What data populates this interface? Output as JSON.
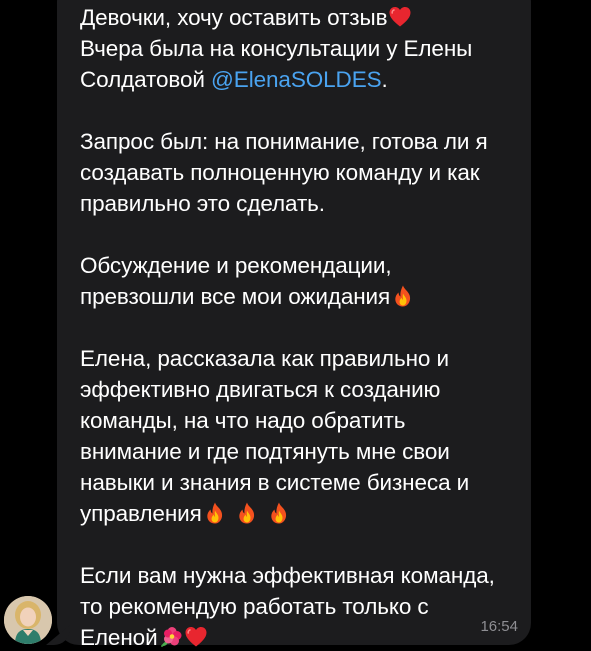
{
  "message": {
    "lines": [
      "Девочки, хочу оставить отзыв",
      "Вчера была на консультации у Елены",
      "Солдатовой ",
      "Запрос был: на понимание, готова ли я",
      "создавать полноценную команду и как",
      "правильно это сделать.",
      "Обсуждение и рекомендации,",
      "превзошли все мои ожидания",
      "Елена, рассказала как правильно и",
      "эффективно двигаться к созданию",
      "команды, на что надо обратить",
      "внимание и где подтянуть мне свои",
      "навыки и знания в системе бизнеса и",
      "управления",
      "Если вам нужна эффективная команда,",
      "то рекомендую работать только с",
      "Еленой"
    ],
    "mention": "@ElenaSOLDES",
    "mention_suffix": ".",
    "time": "16:54"
  },
  "icons": {
    "heart": "red-heart-emoji",
    "fire": "fire-emoji",
    "flower": "hibiscus-emoji",
    "avatar": "sender-avatar"
  },
  "colors": {
    "background": "#000000",
    "bubble": "#1c1c1e",
    "text": "#ffffff",
    "mention": "#4aa3f0",
    "timestamp": "#8e8e93"
  }
}
